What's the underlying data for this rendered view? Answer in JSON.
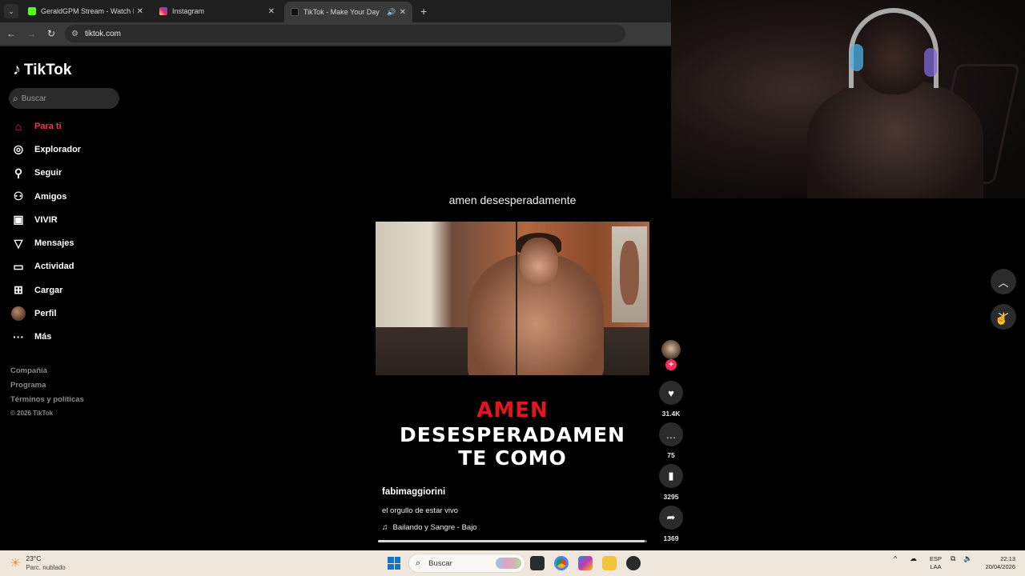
{
  "browser": {
    "tabs": [
      {
        "title": "GeraldGPM Stream - Watch Live",
        "favicon_color": "#53fc18",
        "active": false
      },
      {
        "title": "Instagram",
        "favicon_color": "#d62976",
        "active": false
      },
      {
        "title": "TikTok - Make Your Day",
        "favicon_color": "#111111",
        "active": true
      }
    ],
    "url": "tiktok.com"
  },
  "tiktok": {
    "brand": "TikTok",
    "search_placeholder": "Buscar",
    "nav": [
      {
        "label": "Para ti",
        "icon": "home-icon",
        "active": true
      },
      {
        "label": "Explorador",
        "icon": "compass-icon",
        "active": false
      },
      {
        "label": "Seguir",
        "icon": "following-icon",
        "active": false
      },
      {
        "label": "Amigos",
        "icon": "friends-icon",
        "active": false
      },
      {
        "label": "VIVIR",
        "icon": "live-icon",
        "active": false
      },
      {
        "label": "Mensajes",
        "icon": "messages-icon",
        "active": false
      },
      {
        "label": "Actividad",
        "icon": "activity-icon",
        "active": false
      },
      {
        "label": "Cargar",
        "icon": "upload-icon",
        "active": false
      },
      {
        "label": "Perfil",
        "icon": "profile-avatar",
        "active": false
      },
      {
        "label": "Más",
        "icon": "more-icon",
        "active": false
      }
    ],
    "footer": [
      "Compañía",
      "Programa",
      "Términos y políticas"
    ],
    "copyright": "© 2026 TikTok"
  },
  "video": {
    "caption_top": "amen desesperadamente",
    "overlay_red": "AMEN",
    "overlay_white_1": "DESESPERADAMEN",
    "overlay_white_2": "TE COMO",
    "author": "fabimaggiorini",
    "description": "el orgullo de estar vivo",
    "music": "Bailando y Sangre - Bajo",
    "progress": 0.99
  },
  "actions": {
    "likes": "31.4K",
    "comments": "75",
    "saves": "3295",
    "shares": "1369"
  },
  "taskbar": {
    "temperature": "23°C",
    "condition": "Parc. nublado",
    "search_placeholder": "Buscar",
    "lang_1": "ESP",
    "lang_2": "LAA",
    "time": "22:13",
    "date": "20/04/2026"
  },
  "colors": {
    "accent": "#fe2c55",
    "overlay_red": "#e3161f"
  }
}
